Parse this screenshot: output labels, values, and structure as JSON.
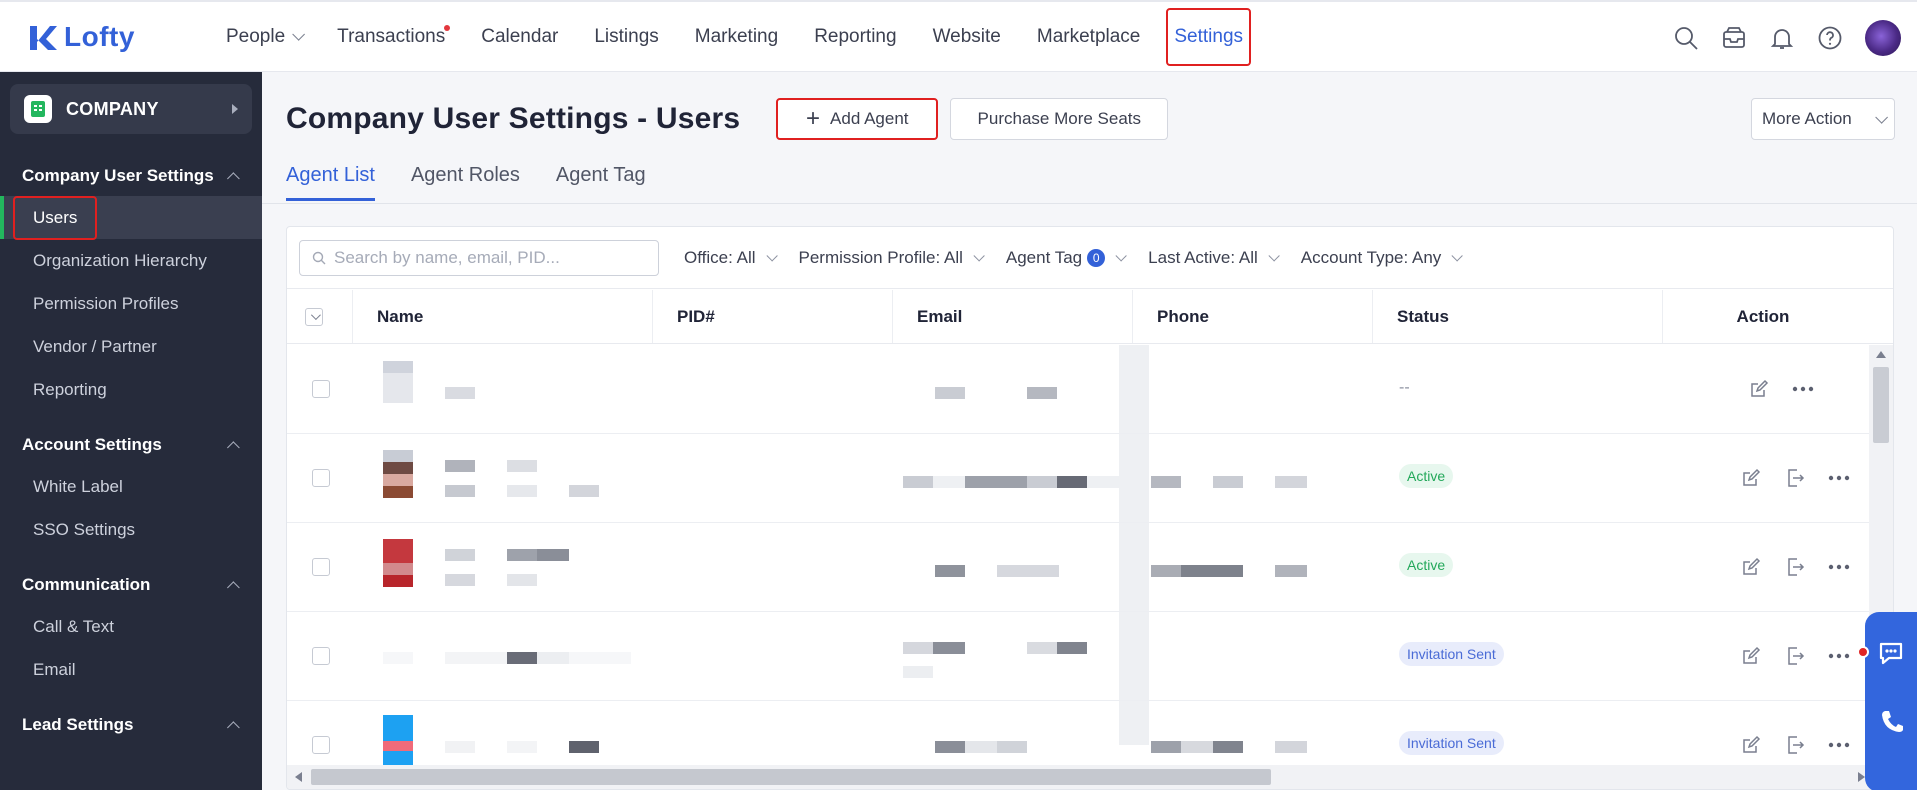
{
  "brand": {
    "name": "Lofty",
    "accent": "#3361d8"
  },
  "nav": {
    "items": [
      {
        "label": "People",
        "has_dropdown": true
      },
      {
        "label": "Transactions",
        "has_dot": true
      },
      {
        "label": "Calendar"
      },
      {
        "label": "Listings"
      },
      {
        "label": "Marketing"
      },
      {
        "label": "Reporting"
      },
      {
        "label": "Website"
      },
      {
        "label": "Marketplace"
      },
      {
        "label": "Settings",
        "selected": true
      }
    ],
    "icons": [
      "search-icon",
      "inbox-icon",
      "bell-icon",
      "help-icon",
      "user-avatar"
    ]
  },
  "sidebar": {
    "company_label": "COMPANY",
    "sections": [
      {
        "title": "Company User Settings",
        "items": [
          "Users",
          "Organization Hierarchy",
          "Permission Profiles",
          "Vendor / Partner",
          "Reporting"
        ],
        "active": "Users"
      },
      {
        "title": "Account Settings",
        "items": [
          "White Label",
          "SSO Settings"
        ]
      },
      {
        "title": "Communication",
        "items": [
          "Call & Text",
          "Email"
        ]
      },
      {
        "title": "Lead Settings",
        "items": []
      }
    ]
  },
  "page": {
    "title": "Company User Settings - Users",
    "add_agent": "Add Agent",
    "purchase_seats": "Purchase More Seats",
    "more_action": "More Action",
    "tabs": [
      "Agent List",
      "Agent Roles",
      "Agent Tag"
    ],
    "active_tab": "Agent List"
  },
  "filters": {
    "search_placeholder": "Search by name, email, PID...",
    "office": "Office: All",
    "permission_profile": "Permission Profile: All",
    "agent_tag": "Agent Tag",
    "agent_tag_count": "0",
    "last_active": "Last Active: All",
    "account_type": "Account Type: Any"
  },
  "table": {
    "columns": [
      "Name",
      "PID#",
      "Email",
      "Phone",
      "Status",
      "Action"
    ],
    "rows": [
      {
        "status": "--",
        "status_type": "none",
        "actions": [
          "edit",
          "more"
        ]
      },
      {
        "status": "Active",
        "status_type": "active",
        "actions": [
          "edit",
          "export",
          "more"
        ]
      },
      {
        "status": "Active",
        "status_type": "active",
        "actions": [
          "edit",
          "export",
          "more"
        ]
      },
      {
        "status": "Invitation Sent",
        "status_type": "invite",
        "actions": [
          "edit",
          "export",
          "more"
        ]
      },
      {
        "status": "Invitation Sent",
        "status_type": "invite",
        "actions": [
          "edit",
          "export",
          "more"
        ]
      }
    ]
  },
  "colors": {
    "sidebar_bg": "#262b3b",
    "active_status": "#23a85a",
    "invite_status": "#4a6bd6",
    "highlight_box": "#e02020"
  }
}
